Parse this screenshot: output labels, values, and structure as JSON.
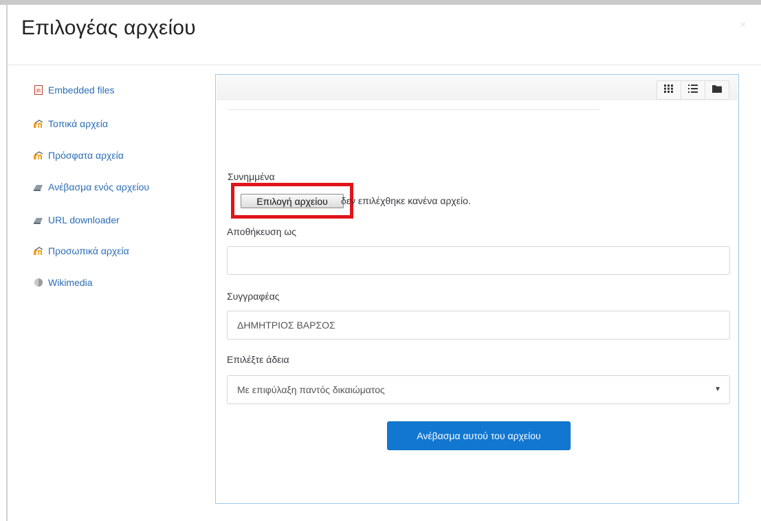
{
  "dialog": {
    "title": "Επιλογέας αρχείου",
    "close_glyph": "×"
  },
  "sidebar": {
    "items": [
      {
        "label": "Embedded files",
        "icon": "pdf-file-icon"
      },
      {
        "label": "Τοπικά αρχεία",
        "icon": "moodle-icon"
      },
      {
        "label": "Πρόσφατα αρχεία",
        "icon": "moodle-icon"
      },
      {
        "label": "Ανέβασμα ενός αρχείου",
        "icon": "upload-icon"
      },
      {
        "label": "URL downloader",
        "icon": "download-icon"
      },
      {
        "label": "Προσωπικά αρχεία",
        "icon": "moodle-icon"
      },
      {
        "label": "Wikimedia",
        "icon": "wikimedia-icon"
      }
    ]
  },
  "toolbar": {
    "views": [
      "icons-view-icon",
      "list-view-icon",
      "tree-view-icon"
    ]
  },
  "form": {
    "attachment_label": "Συνημμένα",
    "choose_file_button": "Επιλογή αρχείου",
    "no_file_text": "δεν επιλέχθηκε κανένα αρχείο.",
    "save_as_label": "Αποθήκευση ως",
    "save_as_value": "",
    "author_label": "Συγγραφέας",
    "author_value": "ΔΗΜΗΤΡΙΟΣ ΒΑΡΣΟΣ",
    "license_label": "Επιλέξτε άδεια",
    "license_value": "Με επιφύλαξη παντός δικαιώματος",
    "upload_button": "Ανέβασμα αυτού του αρχείου"
  },
  "colors": {
    "accent": "#1177d1",
    "link": "#2a6db5",
    "highlight": "#e1141b"
  }
}
